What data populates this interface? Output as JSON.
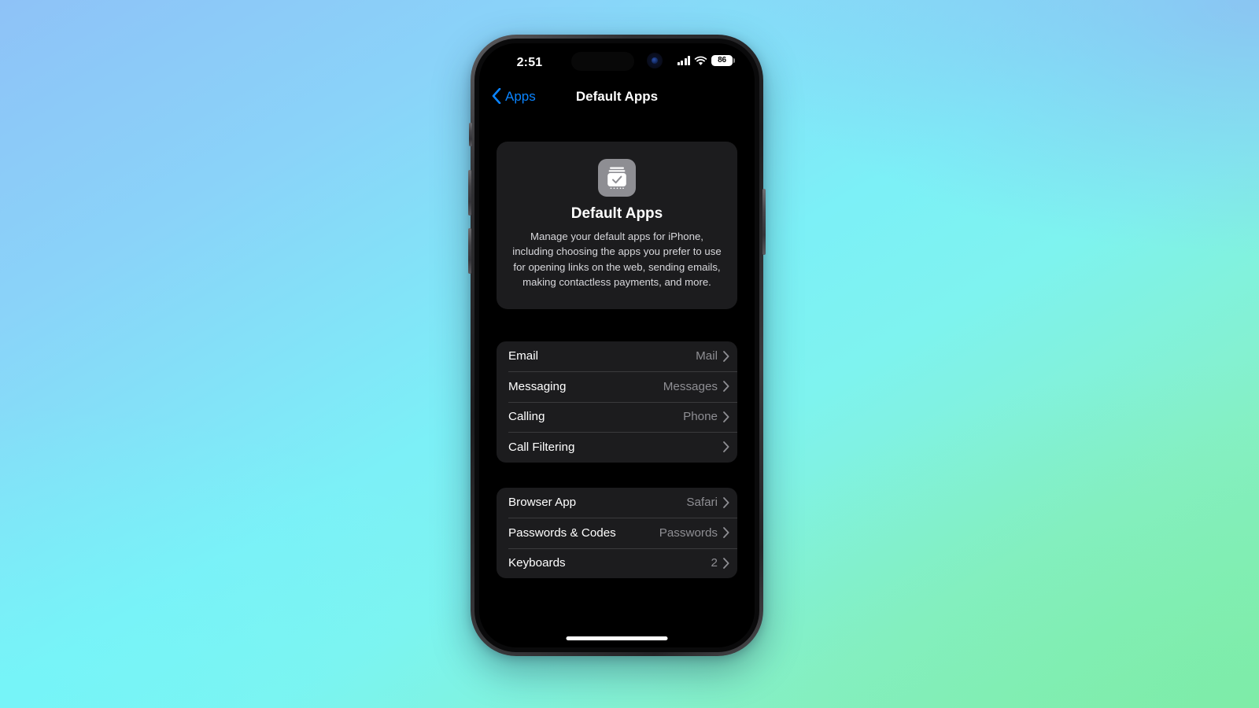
{
  "wallpaper": {
    "gradient_top_left": "#8ec2f7",
    "gradient_top_right": "#a3bef2",
    "gradient_bottom_left": "#7cf3f5",
    "gradient_bottom_right": "#84eeab"
  },
  "device": {
    "frame_color": "#2e2e31",
    "screen_background": "#000000"
  },
  "status_bar": {
    "time": "2:51",
    "cellular_icon": "cellular-bars-icon",
    "wifi_icon": "wifi-icon",
    "battery_icon": "battery-icon",
    "battery_percent": "86"
  },
  "nav_bar": {
    "back_icon": "chevron-left-icon",
    "back_label": "Apps",
    "title": "Default Apps"
  },
  "hero": {
    "icon": "default-apps-icon",
    "icon_background": "#8e8e93",
    "title": "Default Apps",
    "description": "Manage your default apps for iPhone, including choosing the apps you prefer to use for opening links on the web, sending emails, making contactless payments, and more."
  },
  "groups": [
    {
      "id": "communication",
      "rows": [
        {
          "label": "Email",
          "value": "Mail",
          "chevron": "chevron-right-icon"
        },
        {
          "label": "Messaging",
          "value": "Messages",
          "chevron": "chevron-right-icon"
        },
        {
          "label": "Calling",
          "value": "Phone",
          "chevron": "chevron-right-icon"
        },
        {
          "label": "Call Filtering",
          "value": "",
          "chevron": "chevron-right-icon"
        }
      ]
    },
    {
      "id": "system",
      "rows": [
        {
          "label": "Browser App",
          "value": "Safari",
          "chevron": "chevron-right-icon"
        },
        {
          "label": "Passwords & Codes",
          "value": "Passwords",
          "chevron": "chevron-right-icon"
        },
        {
          "label": "Keyboards",
          "value": "2",
          "chevron": "chevron-right-icon"
        }
      ]
    }
  ],
  "home_indicator": "home-indicator",
  "colors": {
    "accent_blue": "#0a84ff",
    "card_background": "#1c1c1e",
    "separator": "#3a3a3c",
    "secondary_text": "#8e8e93",
    "primary_text": "#ffffff"
  }
}
